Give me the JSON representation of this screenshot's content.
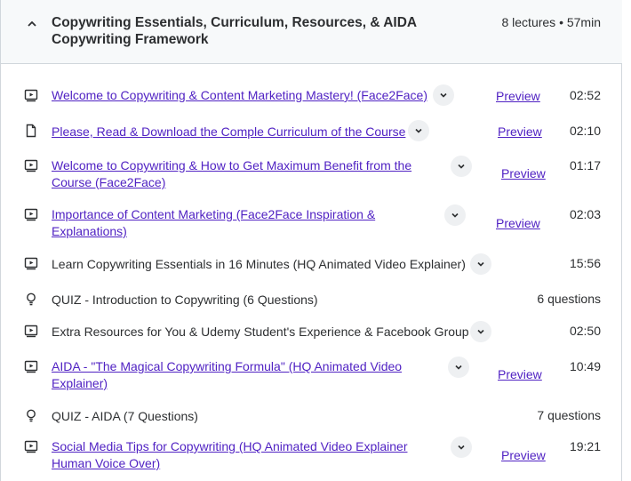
{
  "section": {
    "title": "Copywriting Essentials, Curriculum, Resources, & AIDA Copywriting Framework",
    "meta": "8 lectures • 57min"
  },
  "preview_label": "Preview",
  "items": [
    {
      "icon": "video-icon",
      "title": "Welcome to Copywriting & Content Marketing Mastery! (Face2Face)",
      "duration": "02:52",
      "link": true,
      "preview": true
    },
    {
      "icon": "document-icon",
      "title": "Please, Read & Download the Comple Curriculum of the Course",
      "duration": "02:10",
      "link": true,
      "preview": true
    },
    {
      "icon": "video-icon",
      "title": "Welcome to Copywriting & How to Get Maximum Benefit from the Course (Face2Face)",
      "duration": "01:17",
      "link": true,
      "preview": true
    },
    {
      "icon": "video-icon",
      "title": "Importance of Content Marketing (Face2Face Inspiration & Explanations)",
      "duration": "02:03",
      "link": true,
      "preview": true
    },
    {
      "icon": "video-icon",
      "title": "Learn Copywriting Essentials in 16 Minutes (HQ Animated Video Explainer)",
      "duration": "15:56",
      "link": false,
      "preview": false
    },
    {
      "icon": "lightbulb-icon",
      "title": "QUIZ - Introduction to Copywriting (6 Questions)",
      "duration": "6 questions",
      "link": false,
      "preview": false
    },
    {
      "icon": "video-icon",
      "title": "Extra Resources for You & Udemy Student's Experience & Facebook Group",
      "duration": "02:50",
      "link": false,
      "preview": false
    },
    {
      "icon": "video-icon",
      "title": "AIDA - \"The Magical Copywriting Formula\" (HQ Animated Video Explainer)",
      "duration": "10:49",
      "link": true,
      "preview": true
    },
    {
      "icon": "lightbulb-icon",
      "title": "QUIZ - AIDA (7 Questions)",
      "duration": "7 questions",
      "link": false,
      "preview": false
    },
    {
      "icon": "video-icon",
      "title": "Social Media Tips for Copywriting (HQ Animated Video Explainer Human Voice Over)",
      "duration": "19:21",
      "link": true,
      "preview": true
    }
  ]
}
